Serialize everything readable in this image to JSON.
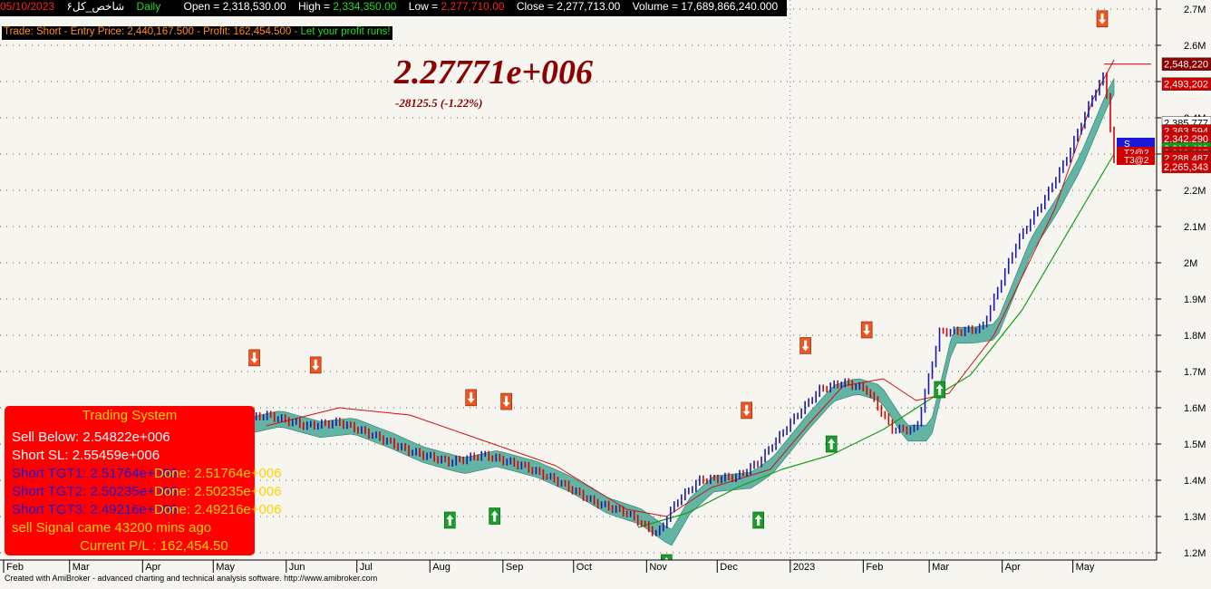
{
  "header": {
    "symbol": "شاخص_کل۶",
    "date": "05/10/2023",
    "interval": "Daily",
    "open_label": "Open = ",
    "open": "2,318,530.00",
    "high_label": "High = ",
    "high": "2,334,350.00",
    "low_label": "Low = ",
    "low": "2,277,710.00",
    "close_label": "Close = ",
    "close": "2,277,713.00",
    "volume_label": "Volume = ",
    "volume": "17,689,866,240.000"
  },
  "trade": {
    "prefix": "Trade: Short - Entry Price: 2,440,167.500 - Profit: 162,454.500",
    "suffix": " - Let your profit runs!"
  },
  "price_display": {
    "value": "2.27771e+006",
    "change": "-28125.5  (-1.22%)"
  },
  "trading_system": {
    "title": "Trading System",
    "sell_below": "Sell Below: 2.54822e+006",
    "short_sl": "Short SL: 2.55459e+006",
    "tgt1": "Short TGT1: 2.51764e+006",
    "tgt1_done": "Done: 2.51764e+006",
    "tgt2": "Short TGT2: 2.50235e+006",
    "tgt2_done": "Done: 2.50235e+006",
    "tgt3": "Short TGT3: 2.49216e+006",
    "tgt3_done": "Done: 2.49216e+006",
    "signal": "sell Signal came 43200 mins ago",
    "pl": "Current P/L : 162,454.50"
  },
  "footer": "Created with AmiBroker - advanced charting and technical analysis software. http://www.amibroker.com",
  "colors": {
    "background": "#f7f5ef",
    "up_bar": "#1a1aa6",
    "down_bar": "#d60000",
    "ribbon": "#48a898",
    "slow_ma": "#d01010",
    "long_ma": "#12a012",
    "buy_arrow": "#1a9e2a",
    "sell_arrow": "#ee5520",
    "panel": "#ff0000"
  },
  "chart_data": {
    "type": "line",
    "title": "",
    "xlabel": "",
    "ylabel": "",
    "x_ticks": [
      "Feb",
      "Mar",
      "Apr",
      "May",
      "Jun",
      "Jul",
      "Aug",
      "Sep",
      "Oct",
      "Nov",
      "Dec",
      "2023",
      "Feb",
      "Mar",
      "Apr",
      "May"
    ],
    "y_ticks": [
      "1.2M",
      "1.3M",
      "1.4M",
      "1.5M",
      "1.6M",
      "1.7M",
      "1.8M",
      "1.9M",
      "2M",
      "2.1M",
      "2.2M",
      "2.3M",
      "2.4M",
      "2.5M",
      "2.6M",
      "2.7M"
    ],
    "ylim": [
      1180000,
      2720000
    ],
    "grid": true,
    "series": [
      {
        "key": "close",
        "x": [
          "2022-02-01",
          "2022-03-01",
          "2022-04-01",
          "2022-05-01",
          "2022-05-15",
          "2022-06-01",
          "2022-06-15",
          "2022-07-01",
          "2022-07-15",
          "2022-08-01",
          "2022-08-15",
          "2022-09-01",
          "2022-09-15",
          "2022-10-01",
          "2022-10-15",
          "2022-10-28",
          "2022-11-05",
          "2022-11-15",
          "2022-12-01",
          "2022-12-10",
          "2022-12-25",
          "2023-01-05",
          "2023-01-15",
          "2023-01-25",
          "2023-02-05",
          "2023-02-15",
          "2023-02-25",
          "2023-03-05",
          "2023-03-15",
          "2023-03-30",
          "2023-04-10",
          "2023-04-20",
          "2023-05-01",
          "2023-05-06",
          "2023-05-10"
        ],
        "values": [
          1500000,
          1520000,
          1540000,
          1560000,
          1580000,
          1550000,
          1560000,
          1520000,
          1480000,
          1450000,
          1470000,
          1440000,
          1400000,
          1340000,
          1310000,
          1250000,
          1340000,
          1400000,
          1410000,
          1450000,
          1570000,
          1650000,
          1670000,
          1650000,
          1540000,
          1540000,
          1810000,
          1810000,
          1820000,
          2060000,
          2170000,
          2290000,
          2460000,
          2520000,
          2277713
        ]
      },
      {
        "key": "slow_ma",
        "x": [
          "2022-05-15",
          "2022-06-15",
          "2022-07-15",
          "2022-08-15",
          "2022-09-15",
          "2022-10-15",
          "2022-11-01",
          "2022-11-20",
          "2022-12-15",
          "2023-01-01",
          "2023-01-15",
          "2023-02-01",
          "2023-02-15",
          "2023-03-01",
          "2023-03-20",
          "2023-04-15",
          "2023-05-01",
          "2023-05-10"
        ],
        "values": [
          1550000,
          1600000,
          1580000,
          1510000,
          1440000,
          1320000,
          1300000,
          1380000,
          1430000,
          1560000,
          1660000,
          1680000,
          1620000,
          1640000,
          1800000,
          2150000,
          2450000,
          2560000
        ]
      },
      {
        "key": "long_ma",
        "x": [
          "2022-10-20",
          "2022-11-10",
          "2022-12-01",
          "2022-12-20",
          "2023-01-10",
          "2023-02-01",
          "2023-02-20",
          "2023-03-10",
          "2023-04-01",
          "2023-04-20",
          "2023-05-10"
        ],
        "values": [
          1270000,
          1310000,
          1380000,
          1430000,
          1470000,
          1540000,
          1620000,
          1690000,
          1870000,
          2080000,
          2300000
        ]
      }
    ],
    "right_labels": [
      "2,548,220",
      "2,493,202",
      "2,385,777",
      "2,363,594",
      "2,342,290",
      "2,314,409",
      "2,302,837",
      "2,291,888",
      "2,288,487",
      "2,265,343"
    ],
    "tag_labels": [
      "S",
      "T2@2",
      "T3@2"
    ],
    "buy_signals": [
      "2022-03-01",
      "2022-08-01",
      "2022-08-20",
      "2022-11-01",
      "2022-12-10",
      "2023-01-10",
      "2023-02-25"
    ],
    "sell_signals": [
      "2022-05-10",
      "2022-06-05",
      "2022-08-10",
      "2022-08-25",
      "2022-12-05",
      "2022-12-30",
      "2023-01-25",
      "2023-05-05"
    ]
  }
}
